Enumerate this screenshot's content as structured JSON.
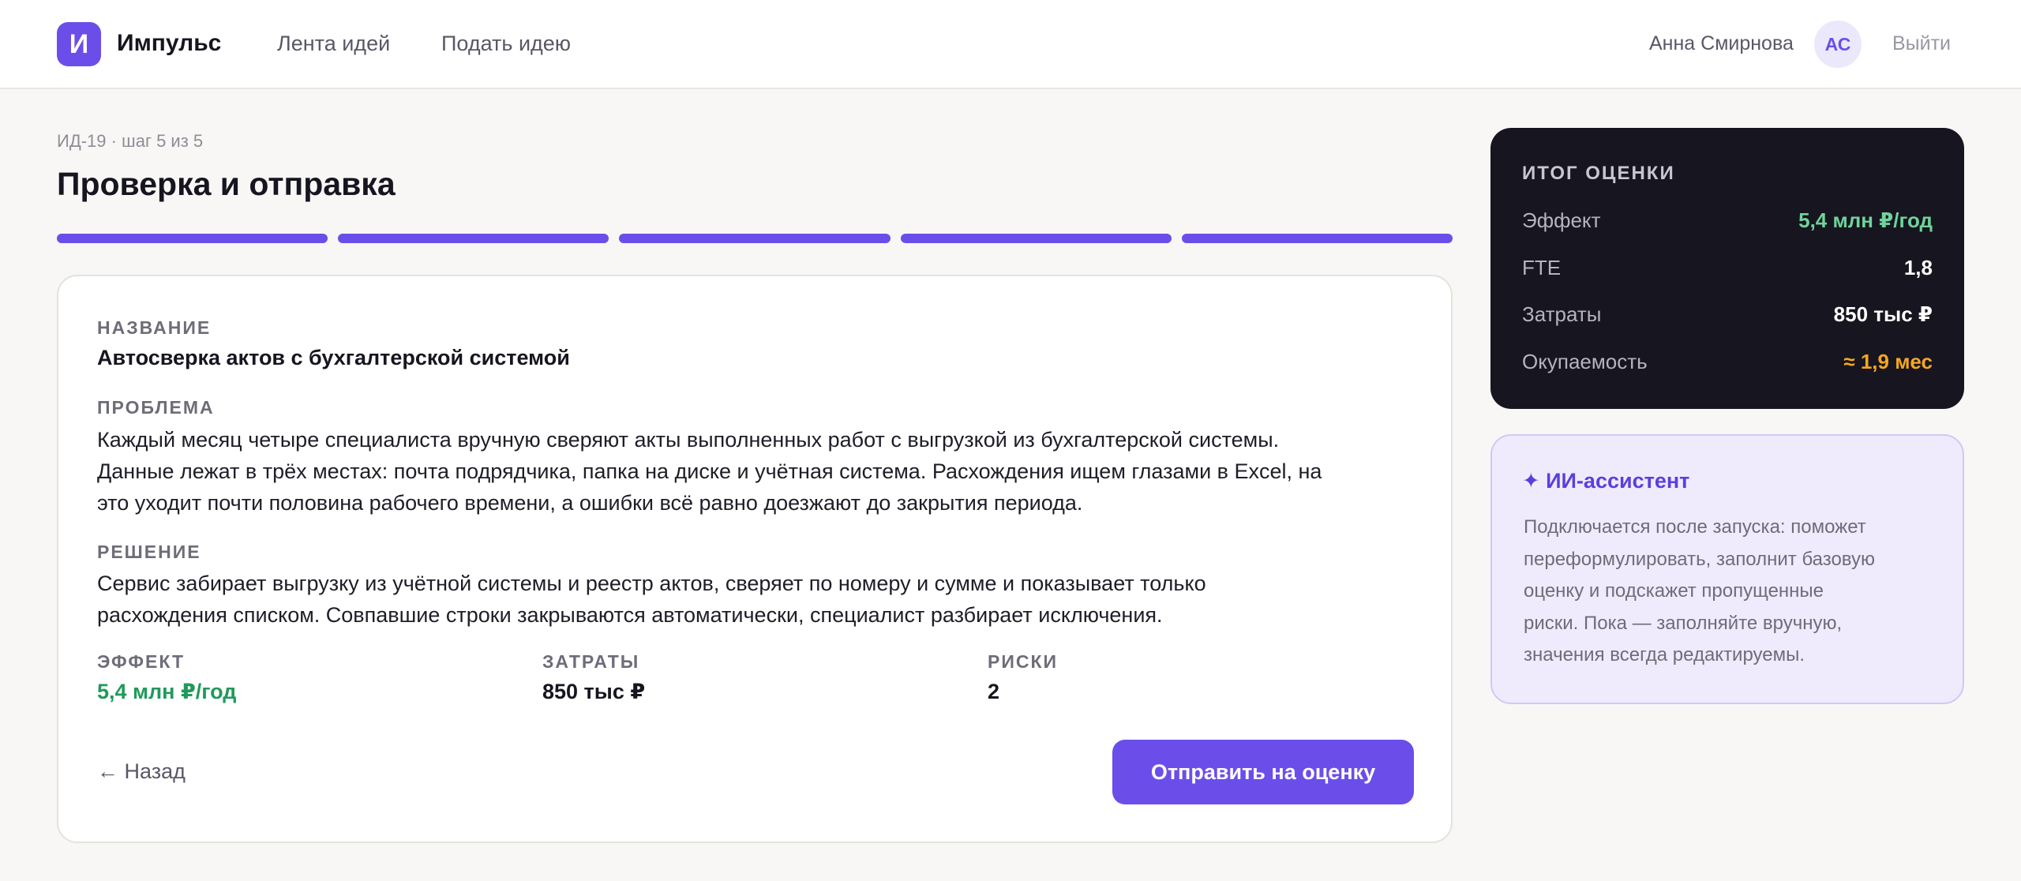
{
  "app": {
    "logo_letter": "И",
    "name": "Импульс"
  },
  "nav": [
    {
      "label": "Лента идей"
    },
    {
      "label": "Подать идею"
    }
  ],
  "user": {
    "name": "Анна Смирнова",
    "initials": "АС",
    "logout": "Выйти"
  },
  "wizard": {
    "meta": "ИД-19 · шаг 5 из 5",
    "title": "Проверка и отправка",
    "progress": {
      "current_step": 5,
      "total_steps": 5
    }
  },
  "review": {
    "name_label": "НАЗВАНИЕ",
    "name_value": "Автосверка актов с бухгалтерской системой",
    "problem_label": "ПРОБЛЕМА",
    "problem_lines": [
      "Каждый месяц четыре специалиста вручную сверяют акты выполненных работ с выгрузкой из бухгалтерской системы.",
      "Данные лежат в трёх местах: почта подрядчика, папка на диске и учётная система. Расхождения ищем глазами в Excel, на",
      "это уходит почти половина рабочего времени, а ошибки всё равно доезжают до закрытия периода."
    ],
    "solution_label": "РЕШЕНИЕ",
    "solution_lines": [
      "Сервис забирает выгрузку из учётной системы и реестр актов, сверяет по номеру и сумме и показывает только",
      "расхождения списком. Совпавшие строки закрываются автоматически, специалист разбирает исключения."
    ],
    "metrics": [
      {
        "label": "ЭФФЕКТ",
        "value": "5,4 млн ₽/год",
        "color": "#1f9a5a"
      },
      {
        "label": "ЗАТРАТЫ",
        "value": "850 тыс ₽",
        "color": "#17151f"
      },
      {
        "label": "РИСКИ",
        "value": "2",
        "color": "#17151f"
      }
    ],
    "back_label": "← Назад",
    "submit_label": "Отправить на оценку"
  },
  "summary": {
    "title": "ИТОГ ОЦЕНКИ",
    "rows": [
      {
        "key": "Эффект",
        "value": "5,4 млн ₽/год",
        "color": "#6fd39b"
      },
      {
        "key": "FTE",
        "value": "1,8",
        "color": "#ffffff"
      },
      {
        "key": "Затраты",
        "value": "850 тыс ₽",
        "color": "#ffffff"
      },
      {
        "key": "Окупаемость",
        "value": "≈ 1,9 мес",
        "color": "#f5a623"
      }
    ]
  },
  "assistant": {
    "title": "✦ ИИ-ассистент",
    "lines": [
      "Подключается после запуска: поможет",
      "переформулировать, заполнит базовую",
      "оценку и подскажет пропущенные",
      "риски. Пока — заполняйте вручную,",
      "значения всегда редактируемы."
    ]
  },
  "colors": {
    "accent": "#6b4eea",
    "positive": "#1f9a5a",
    "warning": "#f5a623",
    "dark_panel": "#17151f"
  }
}
